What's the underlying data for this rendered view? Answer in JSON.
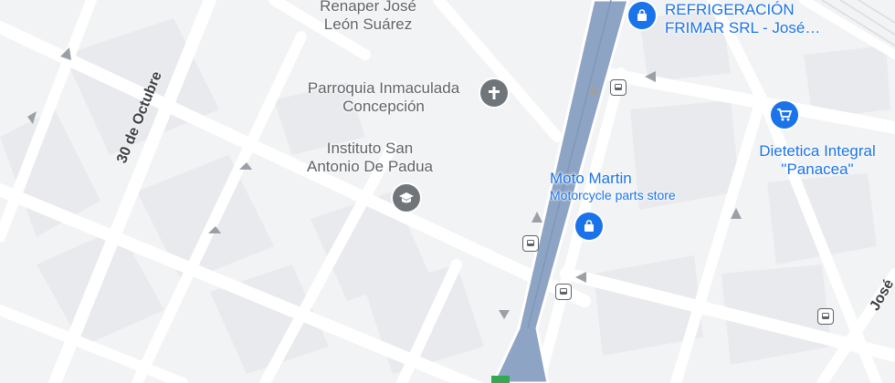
{
  "map": {
    "places": {
      "renaper": [
        "Renaper José",
        "León Suárez"
      ],
      "parroquia": [
        "Parroquia Inmaculada",
        "Concepción"
      ],
      "instituto": [
        "Instituto San",
        "Antonio De Padua"
      ],
      "moto_martin": {
        "name": "Moto Martin",
        "category": "Motorcycle parts store"
      },
      "refrigeracion": [
        "REFRIGERACIÓN",
        "FRIMAR SRL -  José…"
      ],
      "dietetica": [
        "Dietetica Integral",
        "\"Panacea\""
      ]
    },
    "streets": {
      "treinta_octubre": "30 de Octubre",
      "jose_partial": "José"
    },
    "icons": {
      "church": "church-icon",
      "school": "graduation-cap-icon",
      "shopping_bag": "shopping-bag-icon",
      "shopping_cart": "shopping-cart-icon",
      "bus": "bus-stop-icon"
    },
    "colors": {
      "background": "#f1f3f4",
      "road": "#ffffff",
      "highway": "#8ea4c4",
      "poi_blue": "#1a73e8",
      "poi_grey": "#70757a"
    }
  }
}
